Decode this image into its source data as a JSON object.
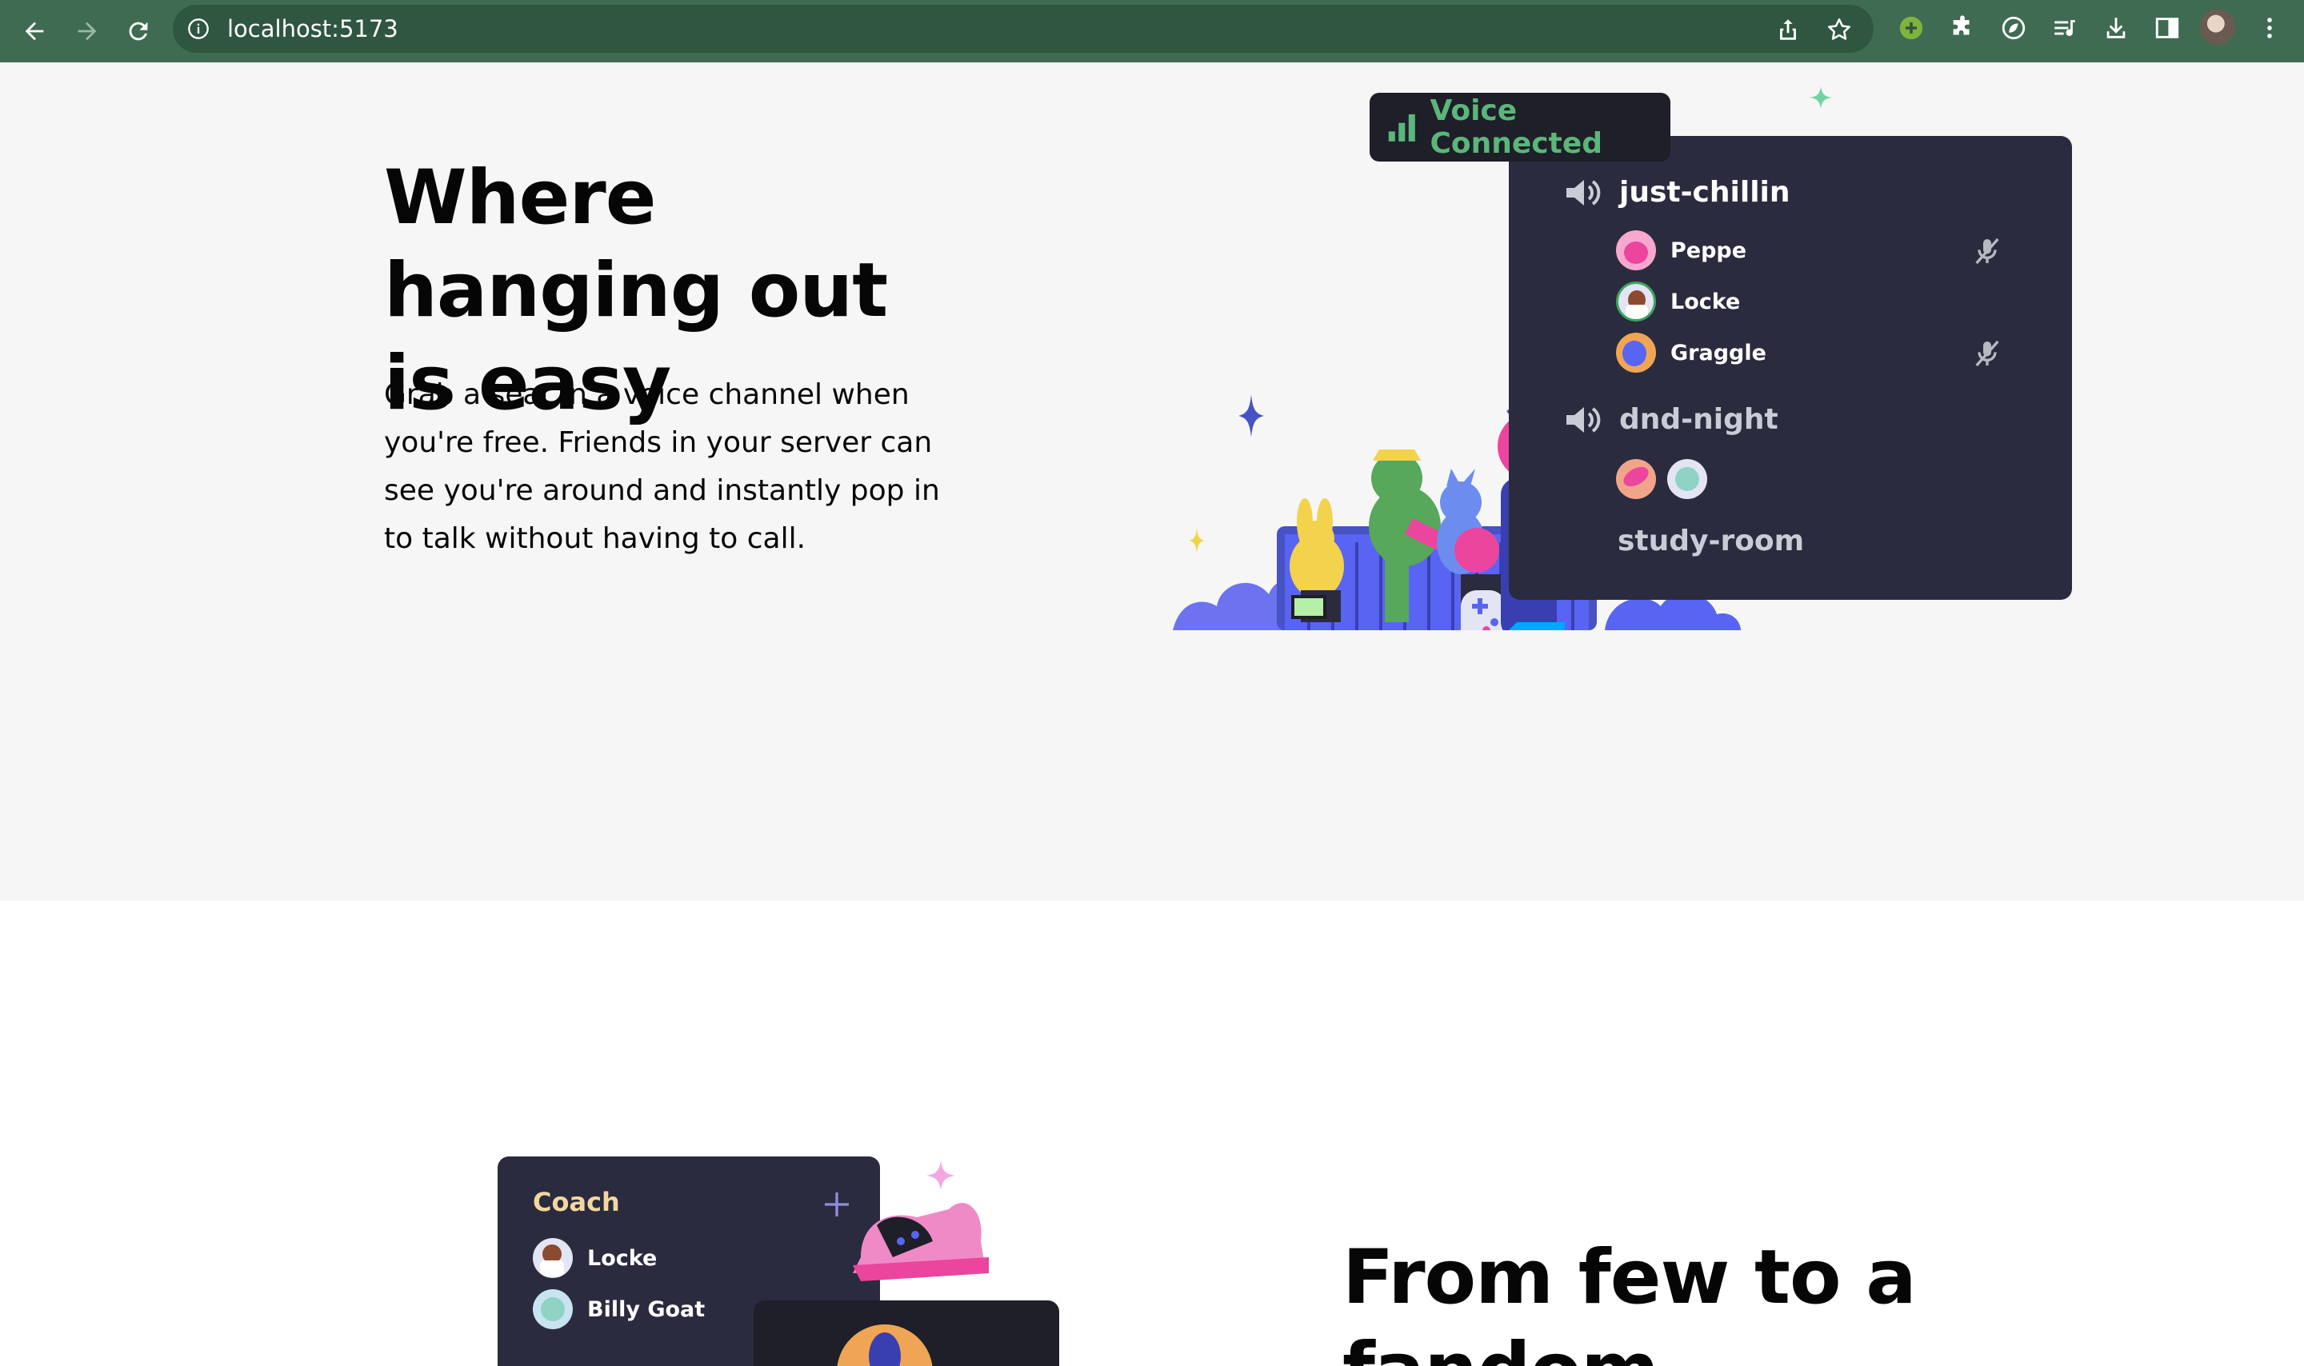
{
  "browser": {
    "url": "localhost:5173",
    "accent": "#3f6b52"
  },
  "hero": {
    "title": "Where hanging out is easy",
    "body": "Grab a seat in a voice channel when you're free. Friends in your server can see you're around and instantly pop in to talk without having to call.",
    "voice_badge": "Voice Connected",
    "channels": [
      {
        "name": "just-chillin",
        "users": [
          {
            "name": "Peppe",
            "muted": true
          },
          {
            "name": "Locke",
            "muted": false
          },
          {
            "name": "Graggle",
            "muted": true
          }
        ]
      },
      {
        "name": "dnd-night"
      },
      {
        "name": "study-room"
      }
    ]
  },
  "section2": {
    "panel_title": "Coach",
    "users": [
      "Locke",
      "Billy Goat"
    ],
    "title": "From few to a fandom"
  },
  "colors": {
    "hero_bg": "#f6f6f6",
    "panel_bg": "#2b2b3f",
    "voice_green": "#5bb67a",
    "blurple": "#5865f2"
  }
}
